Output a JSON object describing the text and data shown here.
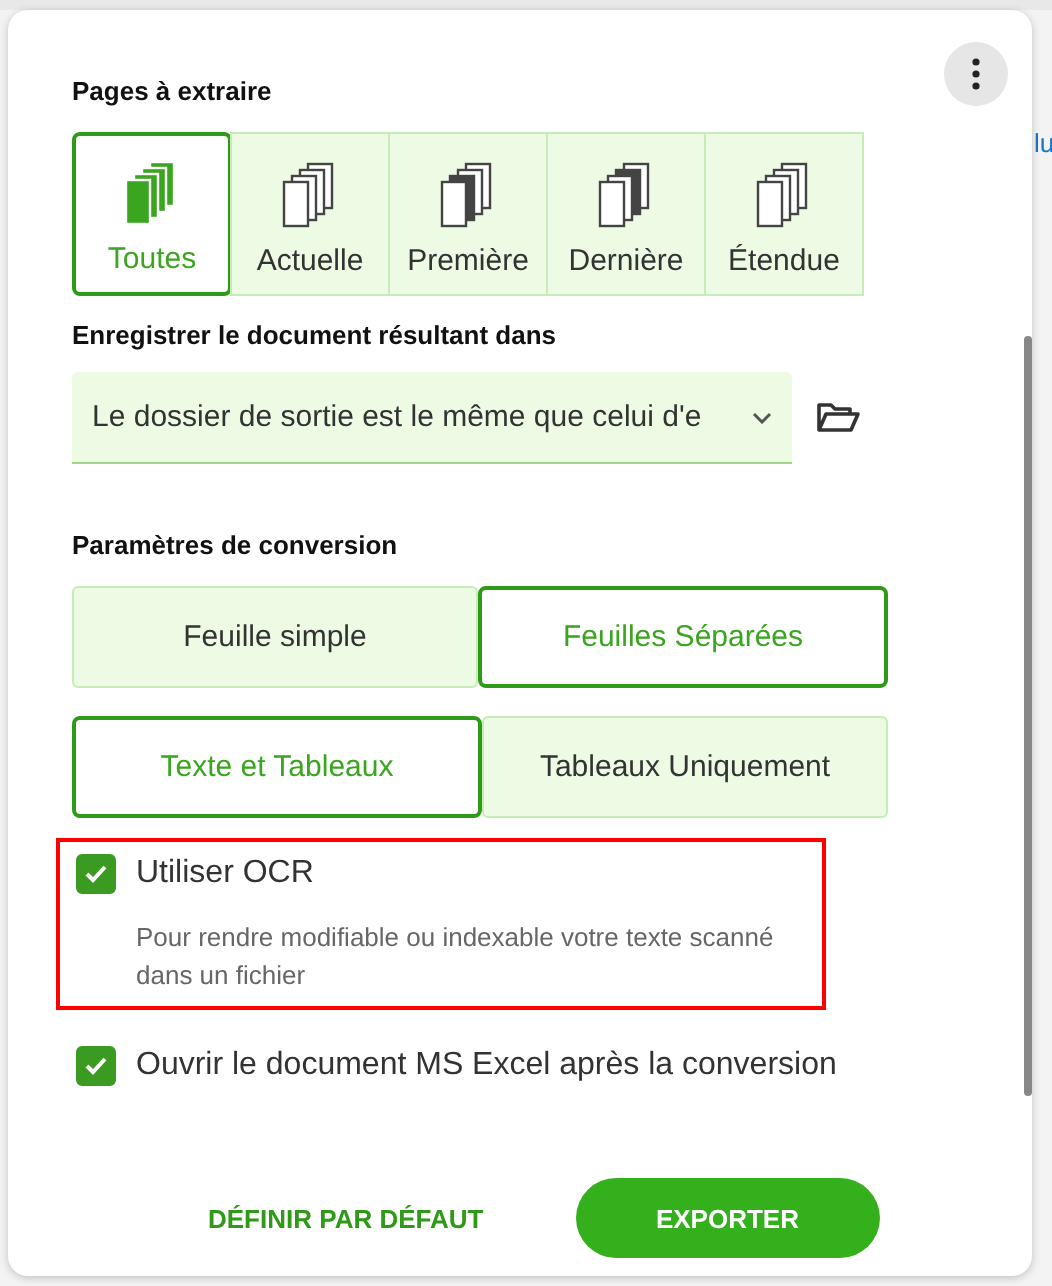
{
  "background_text": "lu",
  "pages": {
    "title": "Pages à extraire",
    "options": [
      {
        "label": "Toutes",
        "selected": true
      },
      {
        "label": "Actuelle",
        "selected": false
      },
      {
        "label": "Première",
        "selected": false
      },
      {
        "label": "Dernière",
        "selected": false
      },
      {
        "label": "Étendue",
        "selected": false
      }
    ]
  },
  "save": {
    "title": "Enregistrer le document résultant dans",
    "value": "Le dossier de sortie est le même que celui d'e"
  },
  "conversion": {
    "title": "Paramètres de conversion",
    "groups": [
      [
        {
          "label": "Feuille simple",
          "selected": false
        },
        {
          "label": "Feuilles Séparées",
          "selected": true
        }
      ],
      [
        {
          "label": "Texte et Tableaux",
          "selected": true
        },
        {
          "label": "Tableaux Uniquement",
          "selected": false
        }
      ]
    ]
  },
  "checkboxes": [
    {
      "label": "Utiliser OCR",
      "checked": true,
      "description": "Pour rendre modifiable ou indexable votre texte scanné dans un fichier",
      "highlighted": true
    },
    {
      "label": "Ouvrir le document MS Excel après la conversion",
      "checked": true,
      "highlighted": false
    }
  ],
  "buttons": {
    "secondary": "DÉFINIR PAR DÉFAUT",
    "primary": "EXPORTER"
  }
}
